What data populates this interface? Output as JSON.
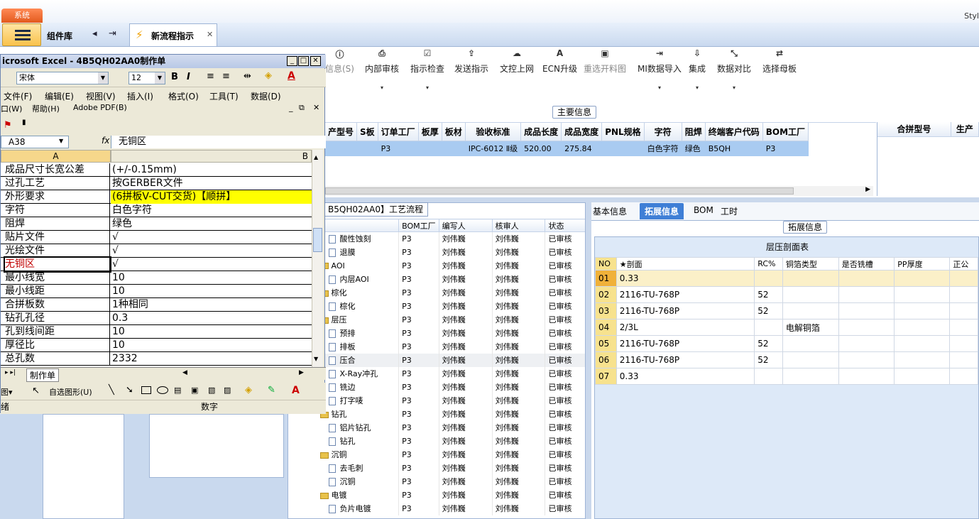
{
  "app": {
    "system_tab": "系统",
    "style_label": "Styl",
    "component_lib": "组件库",
    "tab_title": "新流程指示"
  },
  "toolbar": [
    {
      "label": "信息(S)",
      "icon": "info-icon",
      "disabled": true
    },
    {
      "label": "内部审核",
      "icon": "print-icon",
      "dropdown": true
    },
    {
      "label": "指示检查",
      "icon": "check-icon",
      "dropdown": true
    },
    {
      "label": "发送指示",
      "icon": "upload-icon"
    },
    {
      "label": "文控上网",
      "icon": "cloud-upload-icon"
    },
    {
      "label": "ECN升级",
      "icon": "font-icon"
    },
    {
      "label": "重选开料图",
      "icon": "image-icon",
      "disabled": true
    },
    {
      "label": "MI数据导入",
      "icon": "import-icon",
      "dropdown": true
    },
    {
      "label": "集成",
      "icon": "download-icon",
      "dropdown": true
    },
    {
      "label": "数据对比",
      "icon": "compress-icon",
      "dropdown": true
    },
    {
      "label": "选择母板",
      "icon": "shuffle-icon"
    }
  ],
  "main_info": {
    "header": "主要信息",
    "columns": [
      "产型号",
      "S板",
      "订单工厂",
      "板厚",
      "板材",
      "验收标准",
      "成品长度",
      "成品宽度",
      "PNL规格",
      "字符",
      "阻焊",
      "终端客户代码",
      "BOM工厂"
    ],
    "row": [
      "",
      "",
      "P3",
      "",
      "",
      "IPC-6012 Ⅱ级",
      "520.00",
      "275.84",
      "",
      "白色字符",
      "绿色",
      "B5QH",
      "P3"
    ]
  },
  "right_grid": {
    "columns": [
      "合拼型号",
      "生产"
    ]
  },
  "process": {
    "title": "B5QH02AA0】工艺流程",
    "columns": [
      "",
      "BOM工厂",
      "编写人",
      "核审人",
      "状态"
    ],
    "rows": [
      {
        "name": "酸性蚀刻",
        "kind": "file",
        "factory": "P3",
        "writer": "刘伟巍",
        "reviewer": "刘伟巍",
        "status": "已审核"
      },
      {
        "name": "退膜",
        "kind": "file",
        "factory": "P3",
        "writer": "刘伟巍",
        "reviewer": "刘伟巍",
        "status": "已审核"
      },
      {
        "name": "AOI",
        "kind": "folder",
        "factory": "P3",
        "writer": "刘伟巍",
        "reviewer": "刘伟巍",
        "status": "已审核"
      },
      {
        "name": "内层AOI",
        "kind": "file",
        "factory": "P3",
        "writer": "刘伟巍",
        "reviewer": "刘伟巍",
        "status": "已审核"
      },
      {
        "name": "棕化",
        "kind": "folder",
        "factory": "P3",
        "writer": "刘伟巍",
        "reviewer": "刘伟巍",
        "status": "已审核"
      },
      {
        "name": "棕化",
        "kind": "file",
        "factory": "P3",
        "writer": "刘伟巍",
        "reviewer": "刘伟巍",
        "status": "已审核"
      },
      {
        "name": "层压",
        "kind": "folder",
        "factory": "P3",
        "writer": "刘伟巍",
        "reviewer": "刘伟巍",
        "status": "已审核"
      },
      {
        "name": "预排",
        "kind": "file",
        "factory": "P3",
        "writer": "刘伟巍",
        "reviewer": "刘伟巍",
        "status": "已审核"
      },
      {
        "name": "排板",
        "kind": "file",
        "factory": "P3",
        "writer": "刘伟巍",
        "reviewer": "刘伟巍",
        "status": "已审核"
      },
      {
        "name": "压合",
        "kind": "file",
        "factory": "P3",
        "writer": "刘伟巍",
        "reviewer": "刘伟巍",
        "status": "已审核",
        "selected": true
      },
      {
        "name": "X-Ray冲孔",
        "kind": "file",
        "factory": "P3",
        "writer": "刘伟巍",
        "reviewer": "刘伟巍",
        "status": "已审核"
      },
      {
        "name": "铣边",
        "kind": "file",
        "factory": "P3",
        "writer": "刘伟巍",
        "reviewer": "刘伟巍",
        "status": "已审核"
      },
      {
        "name": "打字唛",
        "kind": "file",
        "factory": "P3",
        "writer": "刘伟巍",
        "reviewer": "刘伟巍",
        "status": "已审核"
      },
      {
        "name": "钻孔",
        "kind": "folder",
        "factory": "P3",
        "writer": "刘伟巍",
        "reviewer": "刘伟巍",
        "status": "已审核"
      },
      {
        "name": "铝片钻孔",
        "kind": "file",
        "factory": "P3",
        "writer": "刘伟巍",
        "reviewer": "刘伟巍",
        "status": "已审核"
      },
      {
        "name": "钻孔",
        "kind": "file",
        "factory": "P3",
        "writer": "刘伟巍",
        "reviewer": "刘伟巍",
        "status": "已审核"
      },
      {
        "name": "沉铜",
        "kind": "folder",
        "factory": "P3",
        "writer": "刘伟巍",
        "reviewer": "刘伟巍",
        "status": "已审核"
      },
      {
        "name": "去毛刺",
        "kind": "file",
        "factory": "P3",
        "writer": "刘伟巍",
        "reviewer": "刘伟巍",
        "status": "已审核"
      },
      {
        "name": "沉铜",
        "kind": "file",
        "factory": "P3",
        "writer": "刘伟巍",
        "reviewer": "刘伟巍",
        "status": "已审核"
      },
      {
        "name": "电镀",
        "kind": "folder",
        "factory": "P3",
        "writer": "刘伟巍",
        "reviewer": "刘伟巍",
        "status": "已审核"
      },
      {
        "name": "负片电镀",
        "kind": "file",
        "factory": "P3",
        "writer": "刘伟巍",
        "reviewer": "刘伟巍",
        "status": "已审核"
      }
    ]
  },
  "ext": {
    "tabs": [
      "基本信息",
      "拓展信息",
      "BOM",
      "工时"
    ],
    "active_tab": "拓展信息",
    "header": "拓展信息",
    "table_title": "层压剖面表",
    "columns": [
      "NO",
      "★剖面",
      "RC%",
      "铜箔类型",
      "是否铣槽",
      "PP厚度",
      "正公"
    ],
    "rows": [
      [
        "01",
        "0.33",
        "",
        "",
        "",
        "",
        ""
      ],
      [
        "02",
        "2116-TU-768P",
        "52",
        "",
        "",
        "",
        ""
      ],
      [
        "03",
        "2116-TU-768P",
        "52",
        "",
        "",
        "",
        ""
      ],
      [
        "04",
        "2/3L",
        "",
        "电解铜箔",
        "",
        "",
        ""
      ],
      [
        "05",
        "2116-TU-768P",
        "52",
        "",
        "",
        "",
        ""
      ],
      [
        "06",
        "2116-TU-768P",
        "52",
        "",
        "",
        "",
        ""
      ],
      [
        "07",
        "0.33",
        "",
        "",
        "",
        "",
        ""
      ]
    ]
  },
  "excel": {
    "title": "icrosoft Excel - 4B5QH02AA0制作单",
    "font": "宋体",
    "size": "12",
    "menu": [
      "文件(F)",
      "编辑(E)",
      "视图(V)",
      "插入(I)",
      "格式(O)",
      "工具(T)",
      "数据(D)"
    ],
    "menu2": [
      "口(W)",
      "帮助(H)",
      "Adobe PDF(B)"
    ],
    "namebox": "A38",
    "formula": "无铜区",
    "fx": "fx",
    "col_a": "A",
    "col_b": "B",
    "rows": [
      {
        "a": "成品尺寸长宽公差",
        "b": "(+/-0.15mm)"
      },
      {
        "a": "过孔工艺",
        "b": "按GERBER文件"
      },
      {
        "a": "外形要求",
        "b": "(6拼板V-CUT交货)【顺拼】",
        "hl": true
      },
      {
        "a": "字符",
        "b": "白色字符"
      },
      {
        "a": "阻焊",
        "b": "绿色"
      },
      {
        "a": "贴片文件",
        "b": "√"
      },
      {
        "a": "光绘文件",
        "b": "√"
      },
      {
        "a": "无铜区",
        "b": "√",
        "active": true
      },
      {
        "a": "最小线宽",
        "b": "10"
      },
      {
        "a": "最小线距",
        "b": "10"
      },
      {
        "a": "合拼板数",
        "b": "1种相同"
      },
      {
        "a": "钻孔孔径",
        "b": "0.3"
      },
      {
        "a": "孔到线间距",
        "b": "10"
      },
      {
        "a": "厚径比",
        "b": "10"
      },
      {
        "a": "总孔数",
        "b": "2332"
      }
    ],
    "sheet_tab": "制作单",
    "draw_label": "自选图形(U)",
    "status_left": "绪",
    "status_mid": "数字"
  }
}
